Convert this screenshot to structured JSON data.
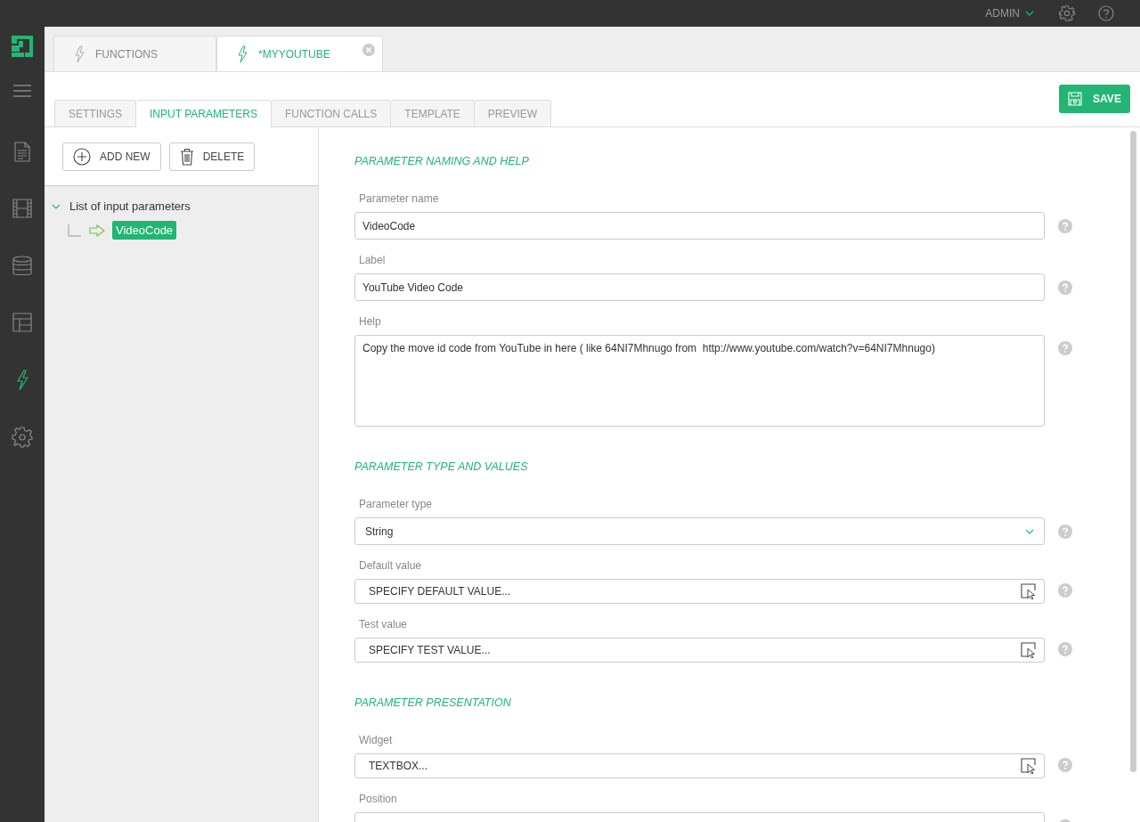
{
  "top_bar": {
    "user": "ADMIN"
  },
  "rail": [
    {
      "kind": "menu",
      "selected": false
    },
    {
      "kind": "document",
      "selected": false
    },
    {
      "kind": "film",
      "selected": false
    },
    {
      "kind": "database",
      "selected": false
    },
    {
      "kind": "layout",
      "selected": false
    },
    {
      "kind": "function",
      "selected": true
    },
    {
      "kind": "settings",
      "selected": false
    }
  ],
  "doc_tabs": [
    {
      "label": "FUNCTIONS",
      "selected": false,
      "closable": false
    },
    {
      "label": "*MYYOUTUBE",
      "selected": true,
      "closable": true
    }
  ],
  "sub_tabs": [
    {
      "label": "SETTINGS",
      "selected": false
    },
    {
      "label": "INPUT PARAMETERS",
      "selected": true
    },
    {
      "label": "FUNCTION CALLS",
      "selected": false
    },
    {
      "label": "TEMPLATE",
      "selected": false
    },
    {
      "label": "PREVIEW",
      "selected": false
    }
  ],
  "save_button": "SAVE",
  "toolbar": [
    {
      "kind": "add",
      "label": "ADD NEW"
    },
    {
      "kind": "delete",
      "label": "DELETE"
    }
  ],
  "tree": {
    "label": "List of input parameters",
    "expanded": true,
    "children": [
      {
        "label": "VideoCode",
        "selected": true
      }
    ]
  },
  "sections": [
    {
      "title": "PARAMETER NAMING AND HELP",
      "fields": [
        {
          "label": "Parameter name",
          "kind": "text",
          "value": "VideoCode"
        },
        {
          "label": "Label",
          "kind": "text",
          "value": "YouTube Video Code"
        },
        {
          "label": "Help",
          "kind": "textarea",
          "value": "Copy the move id code from YouTube in here ( like 64NI7Mhnugo from  http://www.youtube.com/watch?v=64NI7Mhnugo)"
        }
      ]
    },
    {
      "title": "PARAMETER TYPE AND VALUES",
      "fields": [
        {
          "label": "Parameter type",
          "kind": "select",
          "value": "String"
        },
        {
          "label": "Default value",
          "kind": "picker",
          "value": "SPECIFY DEFAULT VALUE..."
        },
        {
          "label": "Test value",
          "kind": "picker",
          "value": "SPECIFY TEST VALUE..."
        }
      ]
    },
    {
      "title": "PARAMETER PRESENTATION",
      "fields": [
        {
          "label": "Widget",
          "kind": "picker",
          "value": "TEXTBOX..."
        },
        {
          "label": "Position",
          "kind": "text"
        }
      ]
    }
  ]
}
